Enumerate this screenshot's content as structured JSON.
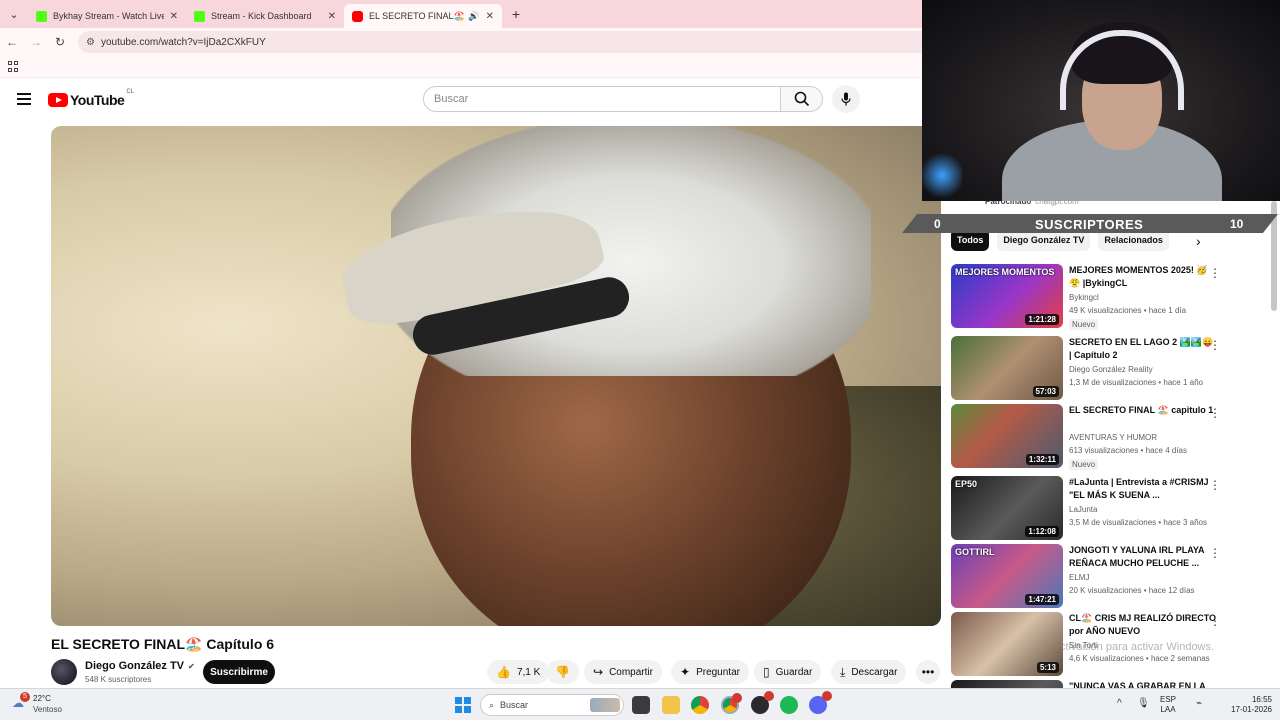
{
  "browser": {
    "tabs": [
      {
        "title": "Bykhay Stream - Watch Live on",
        "icon": "kick-icon"
      },
      {
        "title": "Stream - Kick Dashboard",
        "icon": "kick-icon"
      },
      {
        "title": "EL SECRETO FINAL🏖️ Capí",
        "icon": "youtube-icon"
      }
    ],
    "url": "youtube.com/watch?v=IjDa2CXkFUY"
  },
  "youtube": {
    "logo_text": "YouTube",
    "country_code": "CL",
    "search_placeholder": "Buscar"
  },
  "video": {
    "title": "EL SECRETO FINAL🏖️ Capítulo 6",
    "channel": "Diego González TV",
    "subscribers": "548 K suscriptores",
    "subscribe_label": "Suscribirme",
    "likes": "7,1 K",
    "share_label": "Compartir",
    "ask_label": "Preguntar",
    "save_label": "Guardar",
    "download_label": "Descargar"
  },
  "sidebar": {
    "sponsored": "Patrocinado",
    "sponsor_site": "chatgpt.com",
    "chips": [
      "Todos",
      "Diego González TV",
      "Relacionados"
    ],
    "recommendations": [
      {
        "title": "MEJORES MOMENTOS 2025! 🥳😤 |BykingCL",
        "channel": "Bykingcl",
        "meta": "49 K visualizaciones • hace 1 día",
        "duration": "1:21:28",
        "badge": "Nuevo",
        "thumb_caption": "MEJORES MOMENTOS"
      },
      {
        "title": "SECRETO EN EL LAGO 2 🏞️🏞️😛 | Capítulo 2",
        "channel": "Diego González Reality",
        "meta": "1,3 M de visualizaciones • hace 1 año",
        "duration": "57:03",
        "badge": "",
        "thumb_caption": ""
      },
      {
        "title": "EL SECRETO FINAL 🏖️ capitulo 1",
        "channel": "AVENTURAS Y HUMOR",
        "meta": "613 visualizaciones • hace 4 días",
        "duration": "1:32:11",
        "badge": "Nuevo",
        "thumb_caption": ""
      },
      {
        "title": "#LaJunta | Entrevista a #CRISMJ \"EL MÁS K SUENA ...",
        "channel": "LaJunta",
        "meta": "3,5 M de visualizaciones • hace 3 años",
        "duration": "1:12:08",
        "badge": "",
        "thumb_caption": "EP50"
      },
      {
        "title": "JONGOTI Y YALUNA IRL PLAYA REÑACA MUCHO PELUCHE ...",
        "channel": "ELMJ",
        "meta": "20 K visualizaciones • hace 12 días",
        "duration": "1:47:21",
        "badge": "",
        "thumb_caption": "GOTTIRL"
      },
      {
        "title": "CL🏖️ CRIS MJ REALIZÓ DIRECTO por AÑO NUEVO",
        "channel": "Sin Torti",
        "meta": "4,6 K visualizaciones • hace 2 semanas",
        "duration": "5:13",
        "badge": "",
        "thumb_caption": ""
      }
    ],
    "next_title": "\"NUNCA VAS A GRABAR EN LA"
  },
  "overlay": {
    "sub_goal_current": "0",
    "sub_goal_label": "SUSCRIPTORES",
    "sub_goal_target": "10",
    "watermark": "ctivación para activar Windows."
  },
  "taskbar": {
    "weather_temp": "22°C",
    "weather_cond": "Ventoso",
    "weather_notif": "5",
    "search_label": "Buscar",
    "lang1": "ESP",
    "lang2": "LAA",
    "time": "16:55",
    "date": "17-01-2026"
  }
}
